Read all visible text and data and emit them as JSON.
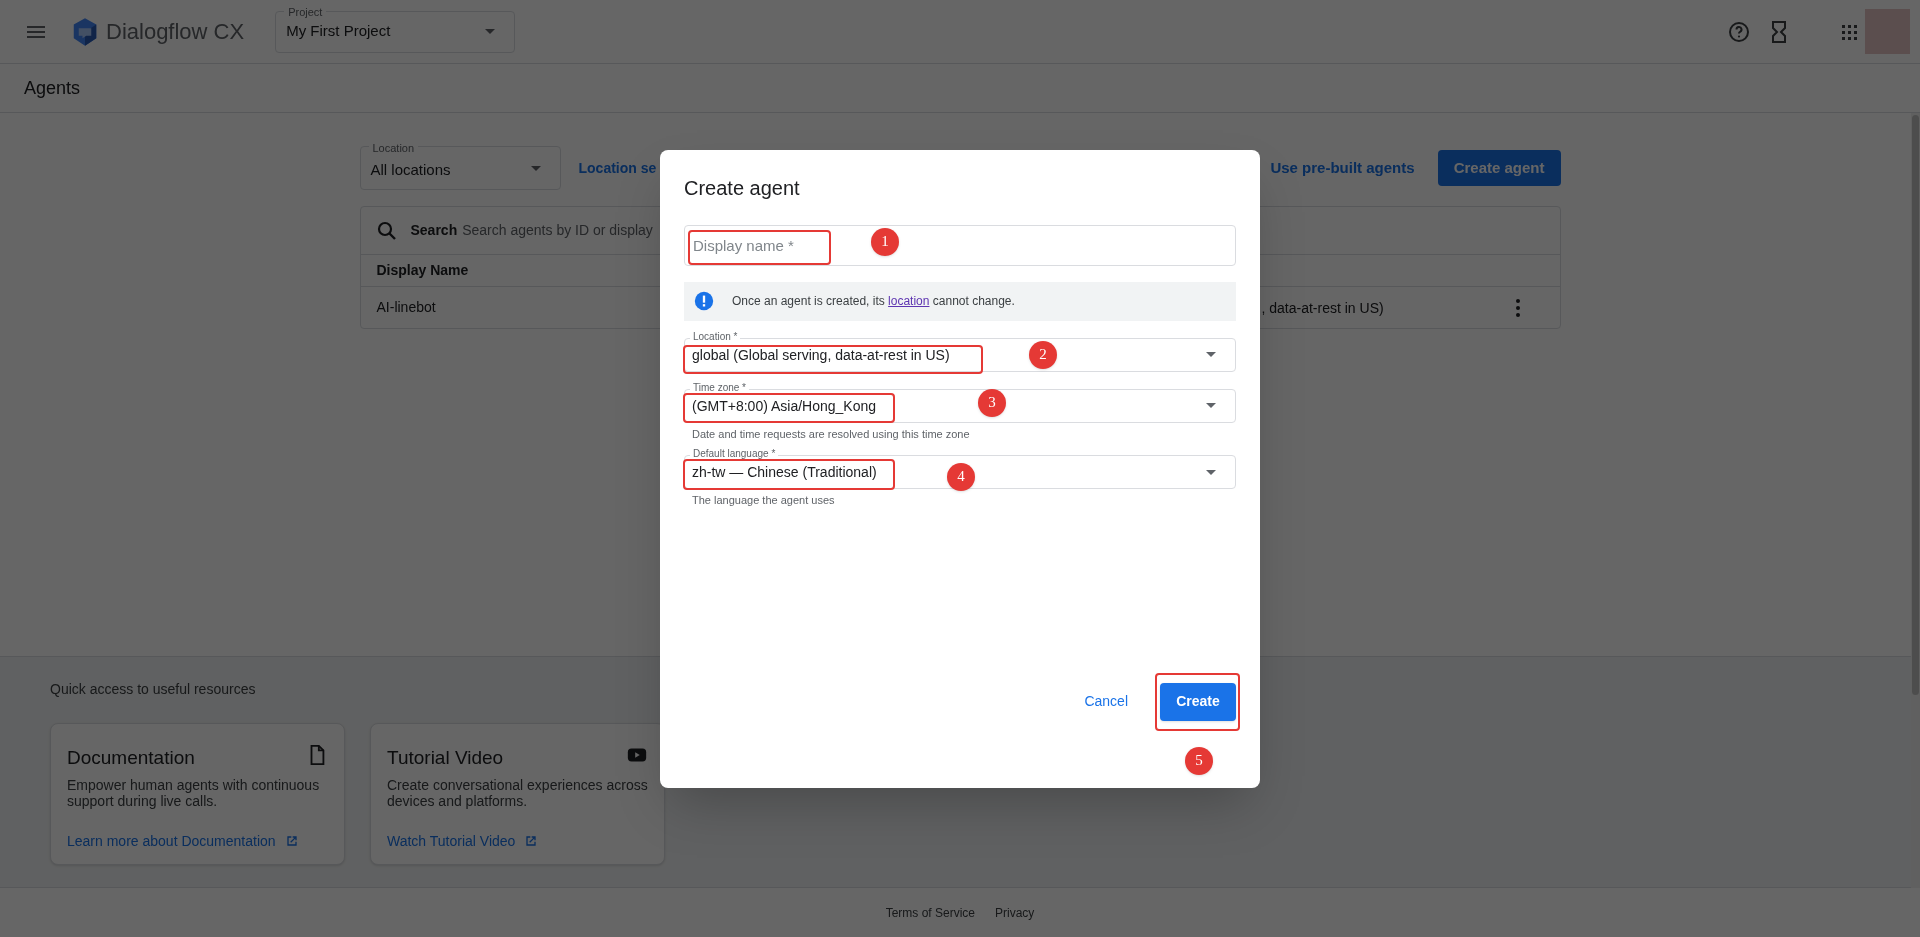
{
  "header": {
    "product_name": "Dialogflow CX",
    "project": {
      "label": "Project",
      "value": "My First Project"
    }
  },
  "page_title": "Agents",
  "toolbar": {
    "location": {
      "label": "Location",
      "value": "All locations"
    },
    "links": [
      "Location se",
      "Use pre-built agents"
    ],
    "create_button": "Create agent"
  },
  "table": {
    "search_label": "Search",
    "search_placeholder": "Search agents by ID or display",
    "columns": [
      "Display Name"
    ],
    "rows": [
      {
        "cells": [
          "AI-linebot",
          ", data-at-rest in US)"
        ]
      }
    ]
  },
  "resources": {
    "title": "Quick access to useful resources",
    "cards": [
      {
        "kind": "document",
        "title": "Documentation",
        "description": "Empower human agents with continuous support during live calls.",
        "link": "Learn more about Documentation"
      },
      {
        "kind": "video",
        "title": "Tutorial Video",
        "description": "Create conversational experiences across devices and platforms.",
        "link": "Watch Tutorial Video"
      }
    ]
  },
  "footer": {
    "links": [
      "Terms of Service",
      "Privacy"
    ]
  },
  "dialog": {
    "title": "Create agent",
    "display_name": {
      "placeholder": "Display name *"
    },
    "notice": {
      "before": "Once an agent is created, its ",
      "link": "location",
      "after": " cannot change."
    },
    "selects": [
      {
        "label": "Location *",
        "value": "global (Global serving, data-at-rest in US)"
      },
      {
        "label": "Time zone *",
        "value": "(GMT+8:00) Asia/Hong_Kong",
        "hint": "Date and time requests are resolved using this time zone"
      },
      {
        "label": "Default language *",
        "value": "zh-tw — Chinese (Traditional)",
        "hint": "The language the agent uses"
      }
    ],
    "buttons": {
      "cancel": "Cancel",
      "create": "Create"
    }
  },
  "annotations": [
    {
      "number": "1"
    },
    {
      "number": "2"
    },
    {
      "number": "3"
    },
    {
      "number": "4"
    },
    {
      "number": "5"
    }
  ]
}
